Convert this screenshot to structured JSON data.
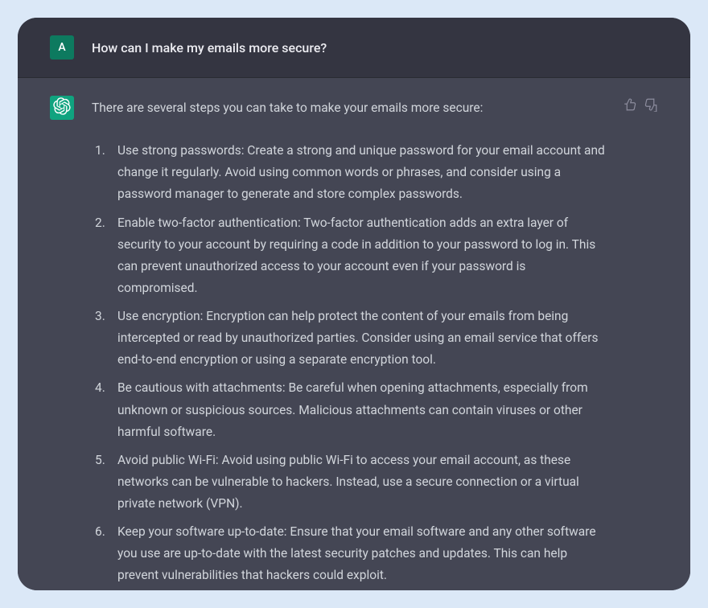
{
  "user": {
    "avatar_letter": "A",
    "message": "How can I make my emails more secure?"
  },
  "assistant": {
    "intro": "There are several steps you can take to make your emails more secure:",
    "items": [
      "Use strong passwords: Create a strong and unique password for your email account and change it regularly. Avoid using common words or phrases, and consider using a password manager to generate and store complex passwords.",
      "Enable two-factor authentication: Two-factor authentication adds an extra layer of security to your account by requiring a code in addition to your password to log in. This can prevent unauthorized access to your account even if your password is compromised.",
      "Use encryption: Encryption can help protect the content of your emails from being intercepted or read by unauthorized parties. Consider using an email service that offers end-to-end encryption or using a separate encryption tool.",
      "Be cautious with attachments: Be careful when opening attachments, especially from unknown or suspicious sources. Malicious attachments can contain viruses or other harmful software.",
      "Avoid public Wi-Fi: Avoid using public Wi-Fi to access your email account, as these networks can be vulnerable to hackers. Instead, use a secure connection or a virtual private network (VPN).",
      "Keep your software up-to-date: Ensure that your email software and any other software you use are up-to-date with the latest security patches and updates. This can help prevent vulnerabilities that hackers could exploit."
    ]
  }
}
